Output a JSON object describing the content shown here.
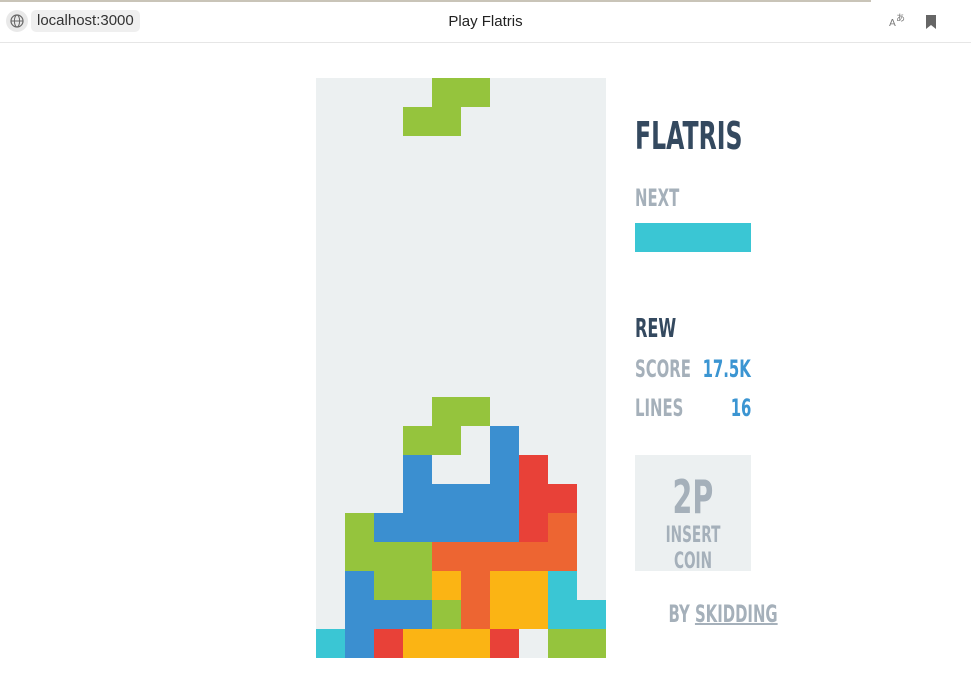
{
  "browser": {
    "url": "localhost:3000",
    "title": "Play Flatris",
    "translate_icon": "translate-icon",
    "bookmark_icon": "bookmark-icon",
    "site_icon": "globe-icon"
  },
  "colors": {
    "well_bg": "#ecf0f1",
    "I": "#3ac6d4",
    "J": "#3b8fd0",
    "O": "#fbb414",
    "S": "#95c43d",
    "Z": "#e84138",
    "L": "#ed6532",
    "T": "#b04497",
    "dark": "#34495f",
    "muted": "#a5b0ba",
    "accent": "#3b95d2"
  },
  "game": {
    "logo": "FLATRIS",
    "next_label": "NEXT",
    "next_piece": "I",
    "player": "REW",
    "score_label": "SCORE",
    "score_value": "17.5K",
    "lines_label": "LINES",
    "lines_value": "16",
    "coin_title": "2P",
    "coin_subtitle": "INSERT COIN",
    "credit_by": "BY",
    "credit_author": "SKIDDING"
  },
  "board": {
    "cols": 10,
    "rows": 20,
    "active_piece": {
      "type": "S",
      "cells": [
        [
          4,
          0
        ],
        [
          5,
          0
        ],
        [
          3,
          1
        ],
        [
          4,
          1
        ]
      ]
    },
    "grid": [
      "..........",
      "..........",
      "..........",
      "..........",
      "..........",
      "..........",
      "..........",
      "..........",
      "..........",
      "..........",
      "..........",
      "....SS....",
      "...SS.J...",
      "...J..JZ..",
      "...JJJJZZ.",
      ".SJJJJJZL.",
      ".SSSLLLLL.",
      ".JSSOLOOI.",
      ".JJJSLOOII",
      "IJZOOOZ.SSS"
    ]
  }
}
